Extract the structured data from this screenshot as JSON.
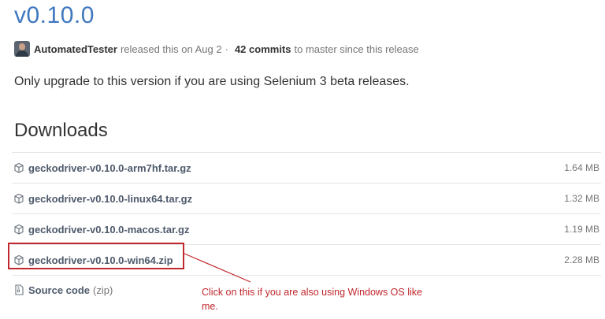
{
  "release": {
    "title": "v0.10.0",
    "author": "AutomatedTester",
    "released_text": "released this on Aug 2",
    "separator": "·",
    "commits": "42 commits",
    "commits_suffix": "to master since this release",
    "notes": "Only upgrade to this version if you are using Selenium 3 beta releases."
  },
  "downloads": {
    "title": "Downloads",
    "files": [
      {
        "name": "geckodriver-v0.10.0-arm7hf.tar.gz",
        "size": "1.64 MB"
      },
      {
        "name": "geckodriver-v0.10.0-linux64.tar.gz",
        "size": "1.32 MB"
      },
      {
        "name": "geckodriver-v0.10.0-macos.tar.gz",
        "size": "1.19 MB"
      },
      {
        "name": "geckodriver-v0.10.0-win64.zip",
        "size": "2.28 MB"
      }
    ],
    "source": {
      "label": "Source code",
      "format": "(zip)"
    }
  },
  "annotation": {
    "text": "Click on this if you are also using Windows OS like me.",
    "color": "#c1272d"
  },
  "icons": {
    "package": "package-icon",
    "source": "file-zip-icon",
    "avatar": "user-avatar"
  },
  "colors": {
    "link": "#4078c0",
    "file_link": "#4e5a6b",
    "muted": "#767676"
  }
}
